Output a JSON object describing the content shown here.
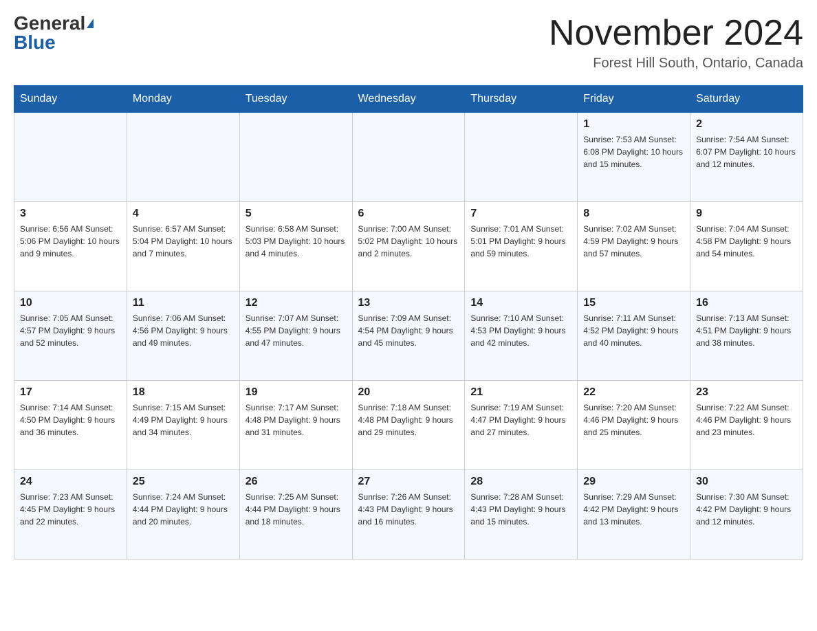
{
  "header": {
    "logo_general": "General",
    "logo_blue": "Blue",
    "month_title": "November 2024",
    "location": "Forest Hill South, Ontario, Canada"
  },
  "days_of_week": [
    "Sunday",
    "Monday",
    "Tuesday",
    "Wednesday",
    "Thursday",
    "Friday",
    "Saturday"
  ],
  "weeks": [
    {
      "days": [
        {
          "num": "",
          "info": ""
        },
        {
          "num": "",
          "info": ""
        },
        {
          "num": "",
          "info": ""
        },
        {
          "num": "",
          "info": ""
        },
        {
          "num": "",
          "info": ""
        },
        {
          "num": "1",
          "info": "Sunrise: 7:53 AM\nSunset: 6:08 PM\nDaylight: 10 hours and 15 minutes."
        },
        {
          "num": "2",
          "info": "Sunrise: 7:54 AM\nSunset: 6:07 PM\nDaylight: 10 hours and 12 minutes."
        }
      ]
    },
    {
      "days": [
        {
          "num": "3",
          "info": "Sunrise: 6:56 AM\nSunset: 5:06 PM\nDaylight: 10 hours and 9 minutes."
        },
        {
          "num": "4",
          "info": "Sunrise: 6:57 AM\nSunset: 5:04 PM\nDaylight: 10 hours and 7 minutes."
        },
        {
          "num": "5",
          "info": "Sunrise: 6:58 AM\nSunset: 5:03 PM\nDaylight: 10 hours and 4 minutes."
        },
        {
          "num": "6",
          "info": "Sunrise: 7:00 AM\nSunset: 5:02 PM\nDaylight: 10 hours and 2 minutes."
        },
        {
          "num": "7",
          "info": "Sunrise: 7:01 AM\nSunset: 5:01 PM\nDaylight: 9 hours and 59 minutes."
        },
        {
          "num": "8",
          "info": "Sunrise: 7:02 AM\nSunset: 4:59 PM\nDaylight: 9 hours and 57 minutes."
        },
        {
          "num": "9",
          "info": "Sunrise: 7:04 AM\nSunset: 4:58 PM\nDaylight: 9 hours and 54 minutes."
        }
      ]
    },
    {
      "days": [
        {
          "num": "10",
          "info": "Sunrise: 7:05 AM\nSunset: 4:57 PM\nDaylight: 9 hours and 52 minutes."
        },
        {
          "num": "11",
          "info": "Sunrise: 7:06 AM\nSunset: 4:56 PM\nDaylight: 9 hours and 49 minutes."
        },
        {
          "num": "12",
          "info": "Sunrise: 7:07 AM\nSunset: 4:55 PM\nDaylight: 9 hours and 47 minutes."
        },
        {
          "num": "13",
          "info": "Sunrise: 7:09 AM\nSunset: 4:54 PM\nDaylight: 9 hours and 45 minutes."
        },
        {
          "num": "14",
          "info": "Sunrise: 7:10 AM\nSunset: 4:53 PM\nDaylight: 9 hours and 42 minutes."
        },
        {
          "num": "15",
          "info": "Sunrise: 7:11 AM\nSunset: 4:52 PM\nDaylight: 9 hours and 40 minutes."
        },
        {
          "num": "16",
          "info": "Sunrise: 7:13 AM\nSunset: 4:51 PM\nDaylight: 9 hours and 38 minutes."
        }
      ]
    },
    {
      "days": [
        {
          "num": "17",
          "info": "Sunrise: 7:14 AM\nSunset: 4:50 PM\nDaylight: 9 hours and 36 minutes."
        },
        {
          "num": "18",
          "info": "Sunrise: 7:15 AM\nSunset: 4:49 PM\nDaylight: 9 hours and 34 minutes."
        },
        {
          "num": "19",
          "info": "Sunrise: 7:17 AM\nSunset: 4:48 PM\nDaylight: 9 hours and 31 minutes."
        },
        {
          "num": "20",
          "info": "Sunrise: 7:18 AM\nSunset: 4:48 PM\nDaylight: 9 hours and 29 minutes."
        },
        {
          "num": "21",
          "info": "Sunrise: 7:19 AM\nSunset: 4:47 PM\nDaylight: 9 hours and 27 minutes."
        },
        {
          "num": "22",
          "info": "Sunrise: 7:20 AM\nSunset: 4:46 PM\nDaylight: 9 hours and 25 minutes."
        },
        {
          "num": "23",
          "info": "Sunrise: 7:22 AM\nSunset: 4:46 PM\nDaylight: 9 hours and 23 minutes."
        }
      ]
    },
    {
      "days": [
        {
          "num": "24",
          "info": "Sunrise: 7:23 AM\nSunset: 4:45 PM\nDaylight: 9 hours and 22 minutes."
        },
        {
          "num": "25",
          "info": "Sunrise: 7:24 AM\nSunset: 4:44 PM\nDaylight: 9 hours and 20 minutes."
        },
        {
          "num": "26",
          "info": "Sunrise: 7:25 AM\nSunset: 4:44 PM\nDaylight: 9 hours and 18 minutes."
        },
        {
          "num": "27",
          "info": "Sunrise: 7:26 AM\nSunset: 4:43 PM\nDaylight: 9 hours and 16 minutes."
        },
        {
          "num": "28",
          "info": "Sunrise: 7:28 AM\nSunset: 4:43 PM\nDaylight: 9 hours and 15 minutes."
        },
        {
          "num": "29",
          "info": "Sunrise: 7:29 AM\nSunset: 4:42 PM\nDaylight: 9 hours and 13 minutes."
        },
        {
          "num": "30",
          "info": "Sunrise: 7:30 AM\nSunset: 4:42 PM\nDaylight: 9 hours and 12 minutes."
        }
      ]
    }
  ]
}
